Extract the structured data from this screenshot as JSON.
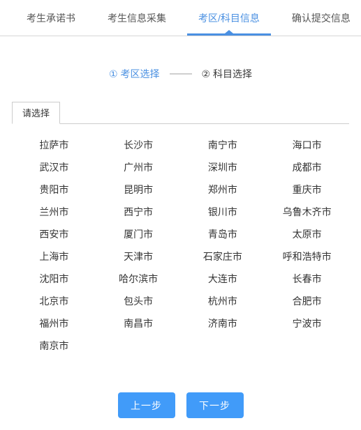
{
  "tabs": [
    {
      "label": "考生承诺书",
      "active": false
    },
    {
      "label": "考生信息采集",
      "active": false
    },
    {
      "label": "考区/科目信息",
      "active": true
    },
    {
      "label": "确认提交信息",
      "active": false
    }
  ],
  "steps": {
    "step1": "① 考区选择",
    "step2": "② 科目选择"
  },
  "panel": {
    "tab_label": "请选择"
  },
  "cities": [
    "拉萨市",
    "长沙市",
    "南宁市",
    "海口市",
    "武汉市",
    "广州市",
    "深圳市",
    "成都市",
    "贵阳市",
    "昆明市",
    "郑州市",
    "重庆市",
    "兰州市",
    "西宁市",
    "银川市",
    "乌鲁木齐市",
    "西安市",
    "厦门市",
    "青岛市",
    "太原市",
    "上海市",
    "天津市",
    "石家庄市",
    "呼和浩特市",
    "沈阳市",
    "哈尔滨市",
    "大连市",
    "长春市",
    "北京市",
    "包头市",
    "杭州市",
    "合肥市",
    "福州市",
    "南昌市",
    "济南市",
    "宁波市",
    "南京市"
  ],
  "footer": {
    "prev_label": "上一步",
    "next_label": "下一步"
  },
  "colors": {
    "accent": "#4a90e2",
    "button": "#419bf9",
    "text": "#333333",
    "border": "#d6d6d6"
  }
}
